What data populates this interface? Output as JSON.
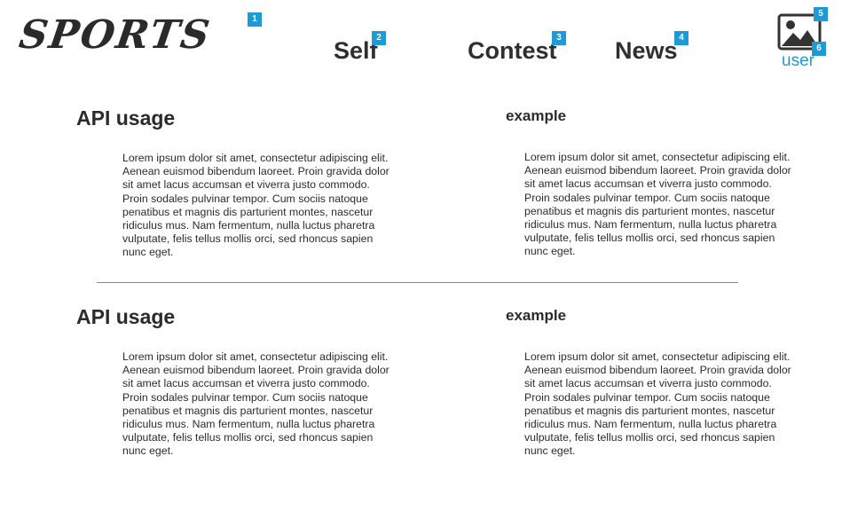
{
  "header": {
    "logo": "SPORTS",
    "nav": [
      {
        "label": "Self",
        "marker": "2"
      },
      {
        "label": "Contest",
        "marker": "3"
      },
      {
        "label": "News",
        "marker": "4"
      }
    ],
    "logo_marker": "1",
    "user": {
      "label": "user",
      "icon": "image-icon",
      "icon_marker": "5",
      "label_marker": "6"
    }
  },
  "sections": [
    {
      "left_title": "API usage",
      "left_text": "Lorem ipsum dolor sit amet, consectetur adipiscing elit. Aenean euismod bibendum laoreet. Proin gravida dolor sit amet lacus accumsan et viverra justo commodo. Proin sodales pulvinar tempor. Cum sociis natoque penatibus et magnis dis parturient montes, nascetur ridiculus mus. Nam fermentum, nulla luctus pharetra vulputate, felis tellus mollis orci, sed rhoncus sapien nunc eget.",
      "right_title": "example",
      "right_text": "Lorem ipsum dolor sit amet, consectetur adipiscing elit. Aenean euismod bibendum laoreet. Proin gravida dolor sit amet lacus accumsan et viverra justo commodo. Proin sodales pulvinar tempor. Cum sociis natoque penatibus et magnis dis parturient montes, nascetur ridiculus mus. Nam fermentum, nulla luctus pharetra vulputate, felis tellus mollis orci, sed rhoncus sapien nunc eget."
    },
    {
      "left_title": "API usage",
      "left_text": "Lorem ipsum dolor sit amet, consectetur adipiscing elit. Aenean euismod bibendum laoreet. Proin gravida dolor sit amet lacus accumsan et viverra justo commodo. Proin sodales pulvinar tempor. Cum sociis natoque penatibus et magnis dis parturient montes, nascetur ridiculus mus. Nam fermentum, nulla luctus pharetra vulputate, felis tellus mollis orci, sed rhoncus sapien nunc eget.",
      "right_title": "example",
      "right_text": "Lorem ipsum dolor sit amet, consectetur adipiscing elit. Aenean euismod bibendum laoreet. Proin gravida dolor sit amet lacus accumsan et viverra justo commodo. Proin sodales pulvinar tempor. Cum sociis natoque penatibus et magnis dis parturient montes, nascetur ridiculus mus. Nam fermentum, nulla luctus pharetra vulputate, felis tellus mollis orci, sed rhoncus sapien nunc eget."
    }
  ],
  "colors": {
    "accent": "#1e9ad6",
    "text": "#2b2b2b",
    "divider": "#8a8a8a"
  }
}
